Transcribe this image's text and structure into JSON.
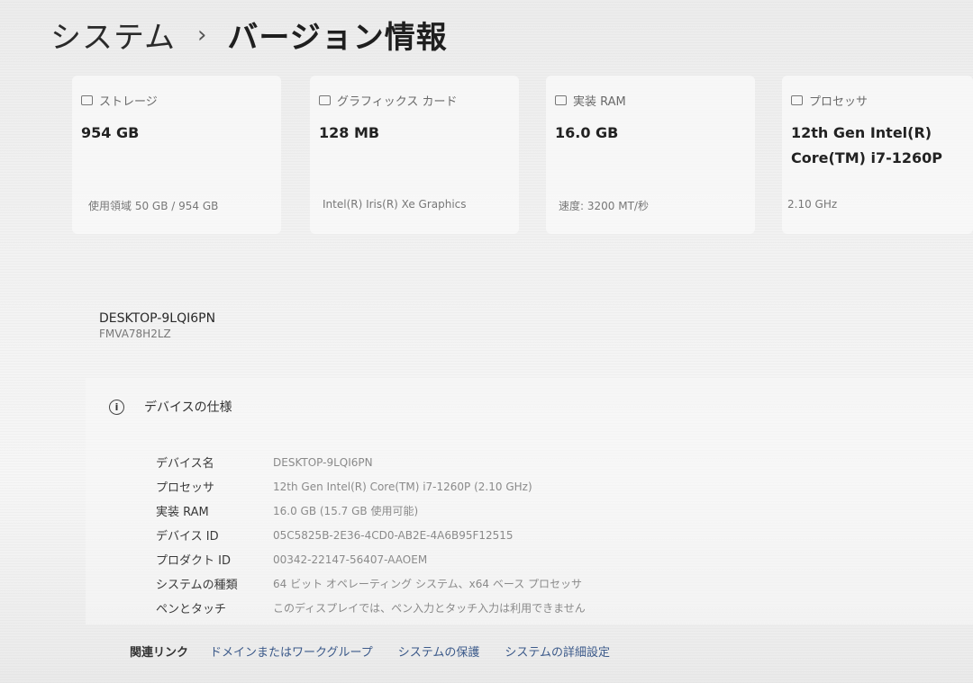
{
  "breadcrumb": {
    "parent": "システム",
    "separator": "›",
    "current": "バージョン情報"
  },
  "cards": [
    {
      "title": "ストレージ",
      "value": "954 GB",
      "sub": "使用領域 50 GB / 954 GB",
      "icon": "storage-icon"
    },
    {
      "title": "グラフィックス カード",
      "value": "128 MB",
      "sub": "Intel(R) Iris(R) Xe Graphics",
      "icon": "graphics-card-icon"
    },
    {
      "title": "実装 RAM",
      "value": "16.0 GB",
      "sub": "速度: 3200 MT/秒",
      "icon": "ram-icon"
    },
    {
      "title": "プロセッサ",
      "value": "12th Gen Intel(R) Core(TM) i7-1260P",
      "sub": "2.10 GHz",
      "icon": "processor-icon"
    }
  ],
  "device": {
    "name": "DESKTOP-9LQI6PN",
    "model": "FMVA78H2LZ"
  },
  "specs": {
    "title": "デバイスの仕様",
    "rows": [
      {
        "key": "デバイス名",
        "value": "DESKTOP-9LQI6PN"
      },
      {
        "key": "プロセッサ",
        "value": "12th Gen Intel(R) Core(TM) i7-1260P (2.10 GHz)"
      },
      {
        "key": "実装 RAM",
        "value": "16.0 GB (15.7 GB 使用可能)"
      },
      {
        "key": "デバイス ID",
        "value": "05C5825B-2E36-4CD0-AB2E-4A6B95F12515"
      },
      {
        "key": "プロダクト ID",
        "value": "00342-22147-56407-AAOEM"
      },
      {
        "key": "システムの種類",
        "value": "64 ビット オペレーティング システム、x64 ベース プロセッサ"
      },
      {
        "key": "ペンとタッチ",
        "value": "このディスプレイでは、ペン入力とタッチ入力は利用できません"
      }
    ]
  },
  "related": {
    "label": "関連リンク",
    "links": [
      "ドメインまたはワークグループ",
      "システムの保護",
      "システムの詳細設定"
    ]
  }
}
